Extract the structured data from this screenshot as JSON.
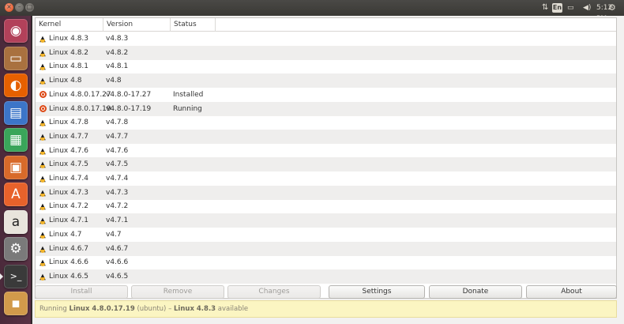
{
  "topbar": {
    "clock": "5:12 PM",
    "keyboard_layout": "En",
    "icons": [
      "network-icon",
      "keyboard-layout-icon",
      "battery-icon",
      "volume-icon",
      "system-gear-icon"
    ]
  },
  "launcher": {
    "items": [
      {
        "name": "ubuntu-dash-icon",
        "glyph": "◉",
        "bg": "#b2415a"
      },
      {
        "name": "files-icon",
        "glyph": "▭",
        "bg": "#a9713f"
      },
      {
        "name": "firefox-icon",
        "glyph": "◐",
        "bg": "#e66000"
      },
      {
        "name": "writer-icon",
        "glyph": "▤",
        "bg": "#3c75c8"
      },
      {
        "name": "calc-icon",
        "glyph": "▦",
        "bg": "#3aa55a"
      },
      {
        "name": "impress-icon",
        "glyph": "▣",
        "bg": "#d86a2a"
      },
      {
        "name": "software-center-icon",
        "glyph": "A",
        "bg": "#e8622b"
      },
      {
        "name": "amazon-icon",
        "glyph": "a",
        "bg": "#e8e4dc"
      },
      {
        "name": "system-settings-icon",
        "glyph": "⚙",
        "bg": "#7a7a7a"
      },
      {
        "name": "terminal-icon",
        "glyph": ">_",
        "bg": "#3a3a3a"
      },
      {
        "name": "ukuu-icon",
        "glyph": "▪",
        "bg": "#d29a4b"
      }
    ]
  },
  "table": {
    "headers": {
      "kernel": "Kernel",
      "version": "Version",
      "status": "Status"
    },
    "rows": [
      {
        "kernel": "Linux 4.8.3",
        "version": "v4.8.3",
        "status": "",
        "icon": "tux-icon"
      },
      {
        "kernel": "Linux 4.8.2",
        "version": "v4.8.2",
        "status": "",
        "icon": "tux-icon"
      },
      {
        "kernel": "Linux 4.8.1",
        "version": "v4.8.1",
        "status": "",
        "icon": "tux-icon"
      },
      {
        "kernel": "Linux 4.8",
        "version": "v4.8",
        "status": "",
        "icon": "tux-icon"
      },
      {
        "kernel": "Linux 4.8.0.17.27",
        "version": "v4.8.0-17.27",
        "status": "Installed",
        "icon": "ubuntu-icon"
      },
      {
        "kernel": "Linux 4.8.0.17.19",
        "version": "v4.8.0-17.19",
        "status": "Running",
        "icon": "ubuntu-icon"
      },
      {
        "kernel": "Linux 4.7.8",
        "version": "v4.7.8",
        "status": "",
        "icon": "tux-icon"
      },
      {
        "kernel": "Linux 4.7.7",
        "version": "v4.7.7",
        "status": "",
        "icon": "tux-icon"
      },
      {
        "kernel": "Linux 4.7.6",
        "version": "v4.7.6",
        "status": "",
        "icon": "tux-icon"
      },
      {
        "kernel": "Linux 4.7.5",
        "version": "v4.7.5",
        "status": "",
        "icon": "tux-icon"
      },
      {
        "kernel": "Linux 4.7.4",
        "version": "v4.7.4",
        "status": "",
        "icon": "tux-icon"
      },
      {
        "kernel": "Linux 4.7.3",
        "version": "v4.7.3",
        "status": "",
        "icon": "tux-icon"
      },
      {
        "kernel": "Linux 4.7.2",
        "version": "v4.7.2",
        "status": "",
        "icon": "tux-icon"
      },
      {
        "kernel": "Linux 4.7.1",
        "version": "v4.7.1",
        "status": "",
        "icon": "tux-icon"
      },
      {
        "kernel": "Linux 4.7",
        "version": "v4.7",
        "status": "",
        "icon": "tux-icon"
      },
      {
        "kernel": "Linux 4.6.7",
        "version": "v4.6.7",
        "status": "",
        "icon": "tux-icon"
      },
      {
        "kernel": "Linux 4.6.6",
        "version": "v4.6.6",
        "status": "",
        "icon": "tux-icon"
      },
      {
        "kernel": "Linux 4.6.5",
        "version": "v4.6.5",
        "status": "",
        "icon": "tux-icon"
      }
    ]
  },
  "buttons": {
    "install": "Install",
    "remove": "Remove",
    "changes": "Changes",
    "settings": "Settings",
    "donate": "Donate",
    "about": "About"
  },
  "statusbar": {
    "prefix": "Running ",
    "running_kernel": "Linux 4.8.0.17.19",
    "middle": " (ubuntu) – ",
    "available_kernel": "Linux 4.8.3",
    "suffix": " available"
  }
}
